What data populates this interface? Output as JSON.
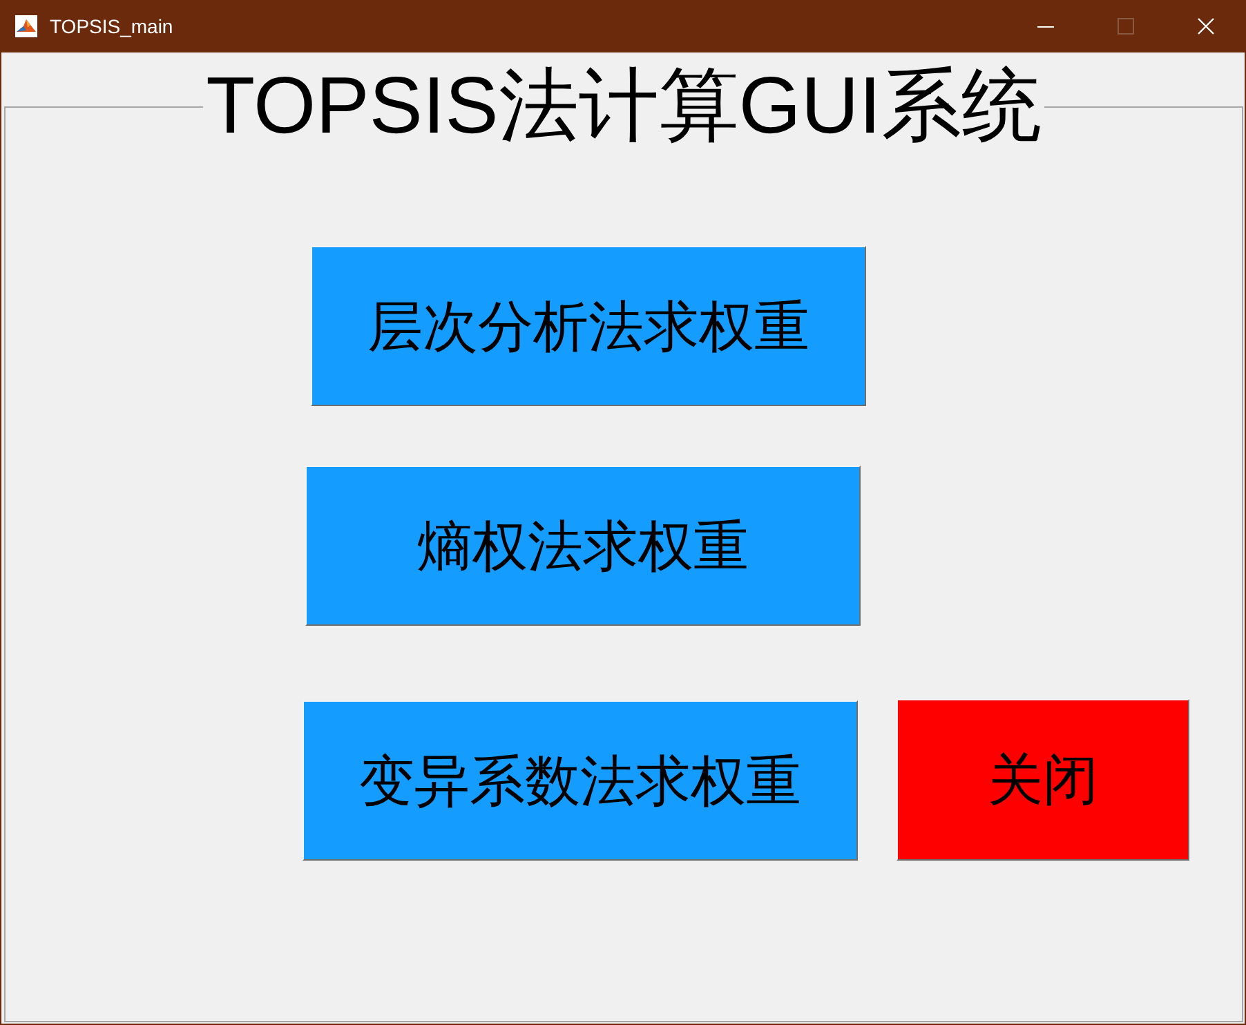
{
  "window": {
    "title": "TOPSIS_main",
    "maximize_disabled": true
  },
  "panel": {
    "title": "TOPSIS法计算GUI系统"
  },
  "rows": [
    {
      "buttons": [
        {
          "label": "层次分析法求权重",
          "color": "#149dff"
        }
      ]
    },
    {
      "buttons": [
        {
          "label": "熵权法求权重",
          "color": "#149dff"
        }
      ]
    },
    {
      "buttons": [
        {
          "label": "变异系数法求权重",
          "color": "#149dff"
        },
        {
          "label": "关闭",
          "color": "#ff0000"
        }
      ]
    }
  ]
}
